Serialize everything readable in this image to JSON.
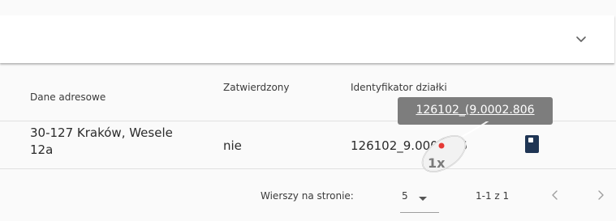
{
  "table": {
    "columns": [
      "Dane adresowe",
      "Zatwierdzony",
      "Identyfikator działki"
    ],
    "rows": [
      {
        "address": "30-127 Kraków, Wesele 12a",
        "approved": "nie",
        "parcel_id": "126102_9.000_806"
      }
    ]
  },
  "tooltip": {
    "text": "126102_(9.0002.806"
  },
  "cursor": {
    "badge": "1x"
  },
  "pagination": {
    "rows_per_page_label": "Wierszy na stronie:",
    "rows_per_page_value": "5",
    "range_text": "1-1 z 1"
  },
  "icons": {
    "accordion": "chevron-down-icon",
    "row_action": "book-icon",
    "prev": "chevron-left-icon",
    "next": "chevron-right-icon"
  },
  "colors": {
    "tooltip_bg": "#7d7d7d",
    "row_icon": "#1f3554",
    "page_bg": "#fafafa"
  }
}
